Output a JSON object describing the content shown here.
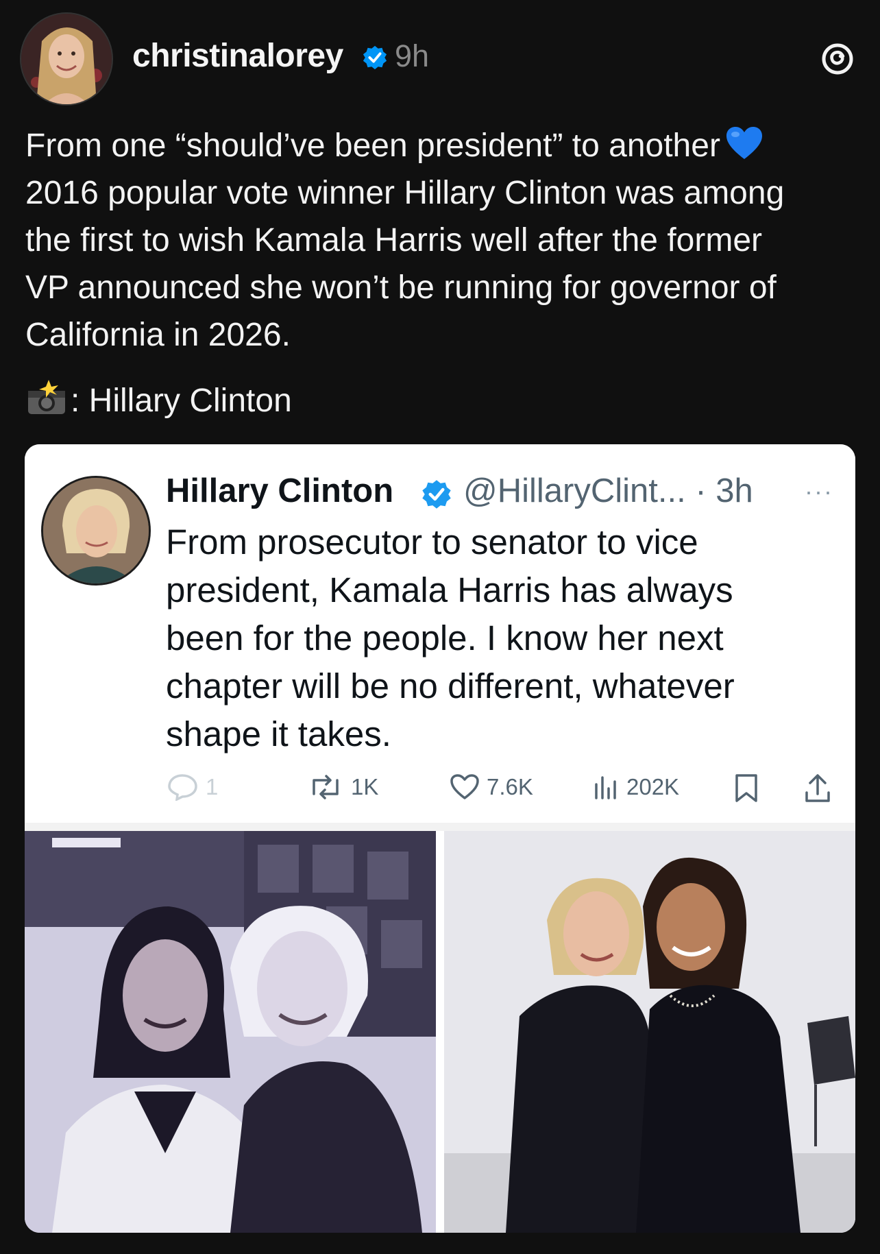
{
  "post": {
    "username": "christinalorey",
    "time": "9h",
    "caption_lines": [
      "From one “should’ve been president” to another",
      "2016 popular vote winner Hillary Clinton was among",
      "the first to wish Kamala Harris well after the former",
      "VP announced she won’t be running for governor of",
      "California in 2026."
    ],
    "credit": ": Hillary Clinton"
  },
  "embedded_tweet": {
    "name": "Hillary Clinton",
    "handle_time": "@HillaryClint... · 3h",
    "more": "···",
    "text_lines": [
      "From prosecutor to senator to vice",
      "president, Kamala Harris has always",
      "been for the people. I know her next",
      "chapter will be no different, whatever",
      "shape it takes."
    ],
    "replies": "1",
    "reposts": "1K",
    "likes": "7.6K",
    "views": "202K"
  },
  "icons": {
    "verified": "verified-badge-icon",
    "threads": "threads-logo-icon",
    "heart_emoji": "blue-heart-emoji",
    "camera_emoji": "camera-flash-emoji"
  },
  "colors": {
    "background": "#101010",
    "verified_blue": "#0095f6",
    "tweet_verified_blue": "#1d9bf0",
    "heart_blue": "#1e7bf0"
  }
}
